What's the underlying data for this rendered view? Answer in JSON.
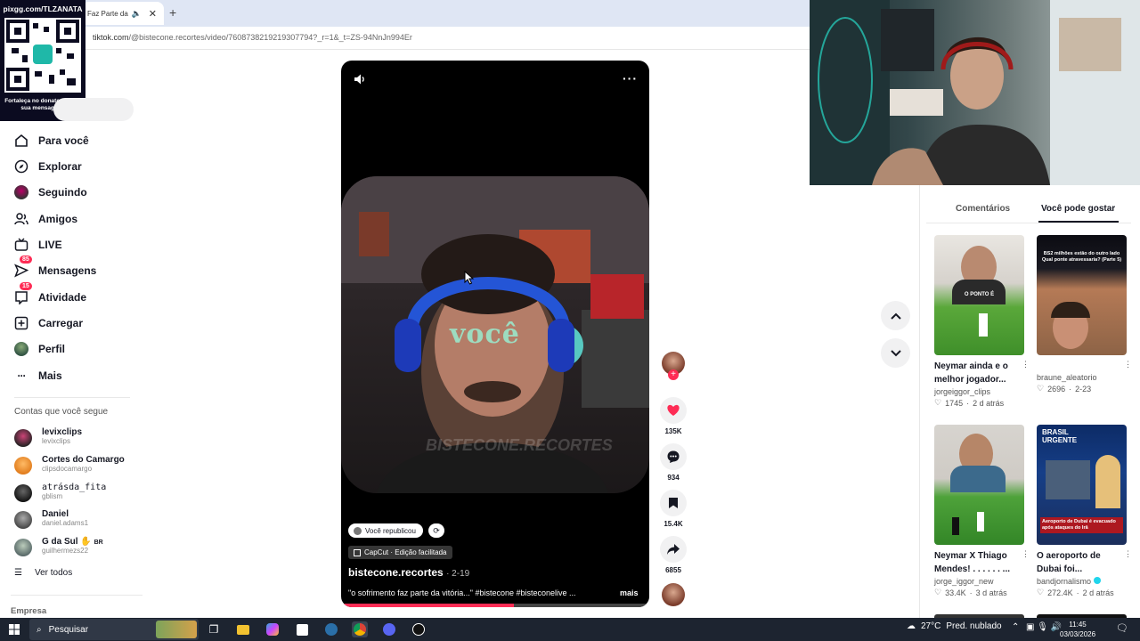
{
  "browser": {
    "tab_title": "Faz Parte da",
    "url_main": "tiktok.com",
    "url_rest": "/@bistecone.recortes/video/7608738219219307794?_r=1&_t=ZS-94NnJn994Er"
  },
  "qr": {
    "top": "pixgg.com/TLZANATA",
    "bottom": "Fortaleça no donate e envie sua mensagem!"
  },
  "sidebar": {
    "items": [
      {
        "label": "Para você"
      },
      {
        "label": "Explorar"
      },
      {
        "label": "Seguindo"
      },
      {
        "label": "Amigos"
      },
      {
        "label": "LIVE"
      },
      {
        "label": "Mensagens",
        "badge": "85"
      },
      {
        "label": "Atividade",
        "badge": "15"
      },
      {
        "label": "Carregar"
      },
      {
        "label": "Perfil"
      },
      {
        "label": "Mais"
      }
    ],
    "following_title": "Contas que você segue",
    "accounts": [
      {
        "name": "levixclips",
        "handle": "levixclips"
      },
      {
        "name": "Cortes do Camargo",
        "handle": "clipsdocamargo"
      },
      {
        "name": "atrásda_fita",
        "handle": "gblism"
      },
      {
        "name": "Daniel",
        "handle": "daniel.adams1"
      },
      {
        "name": "G da Sul",
        "handle": "guilhermezs22",
        "suffix": "BR"
      }
    ],
    "see_all": "Ver todos",
    "company": "Empresa"
  },
  "video": {
    "overlay_word": "você",
    "watermark": "BISTECONE.RECORTES",
    "reposted": "Você republicou",
    "capcut": "CapCut · Edição facilitada",
    "author": "bistecone.recortes",
    "date": "· 2-19",
    "caption": "\"o sofrimento faz parte da vitória...\" #bistecone #bisteconelive ...",
    "more": "mais",
    "progress": 0.56
  },
  "actions": {
    "likes": "135K",
    "comments": "934",
    "saves": "15.4K",
    "shares": "6855"
  },
  "right_panel": {
    "tab_comments": "Comentários",
    "tab_suggest": "Você pode gostar",
    "cards": [
      {
        "title": "Neymar ainda e o melhor jogador...",
        "user": "jorgeiggor_clips",
        "likes": "1745",
        "time": "2 d atrás",
        "thumb_text": "O PONTO É"
      },
      {
        "title": "",
        "user": "braune_aleatorio",
        "likes": "2696",
        "time": "2-23",
        "thumb_text": "BS2 milhões estão do outro lado Qual ponte atravessaria? (Parte 5)"
      },
      {
        "title": "Neymar X Thiago Mendes! . . . . . . ...",
        "user": "jorge_iggor_new",
        "likes": "33.4K",
        "time": "3 d atrás",
        "thumb_text": ""
      },
      {
        "title": "O aeroporto de Dubai foi...",
        "user": "bandjornalismo",
        "likes": "272.4K",
        "time": "2 d atrás",
        "thumb_text": "BRASIL URGENTE",
        "thumb_sub": "Aeroporto de Dubai é evacuado após ataques do Irã"
      }
    ]
  },
  "taskbar": {
    "search": "Pesquisar",
    "temp": "27°C",
    "weather": "Pred. nublado",
    "time": "11:45",
    "date": "03/03/2026"
  },
  "colors": {
    "accent": "#fe2c55",
    "taskbar": "#1d2430"
  }
}
